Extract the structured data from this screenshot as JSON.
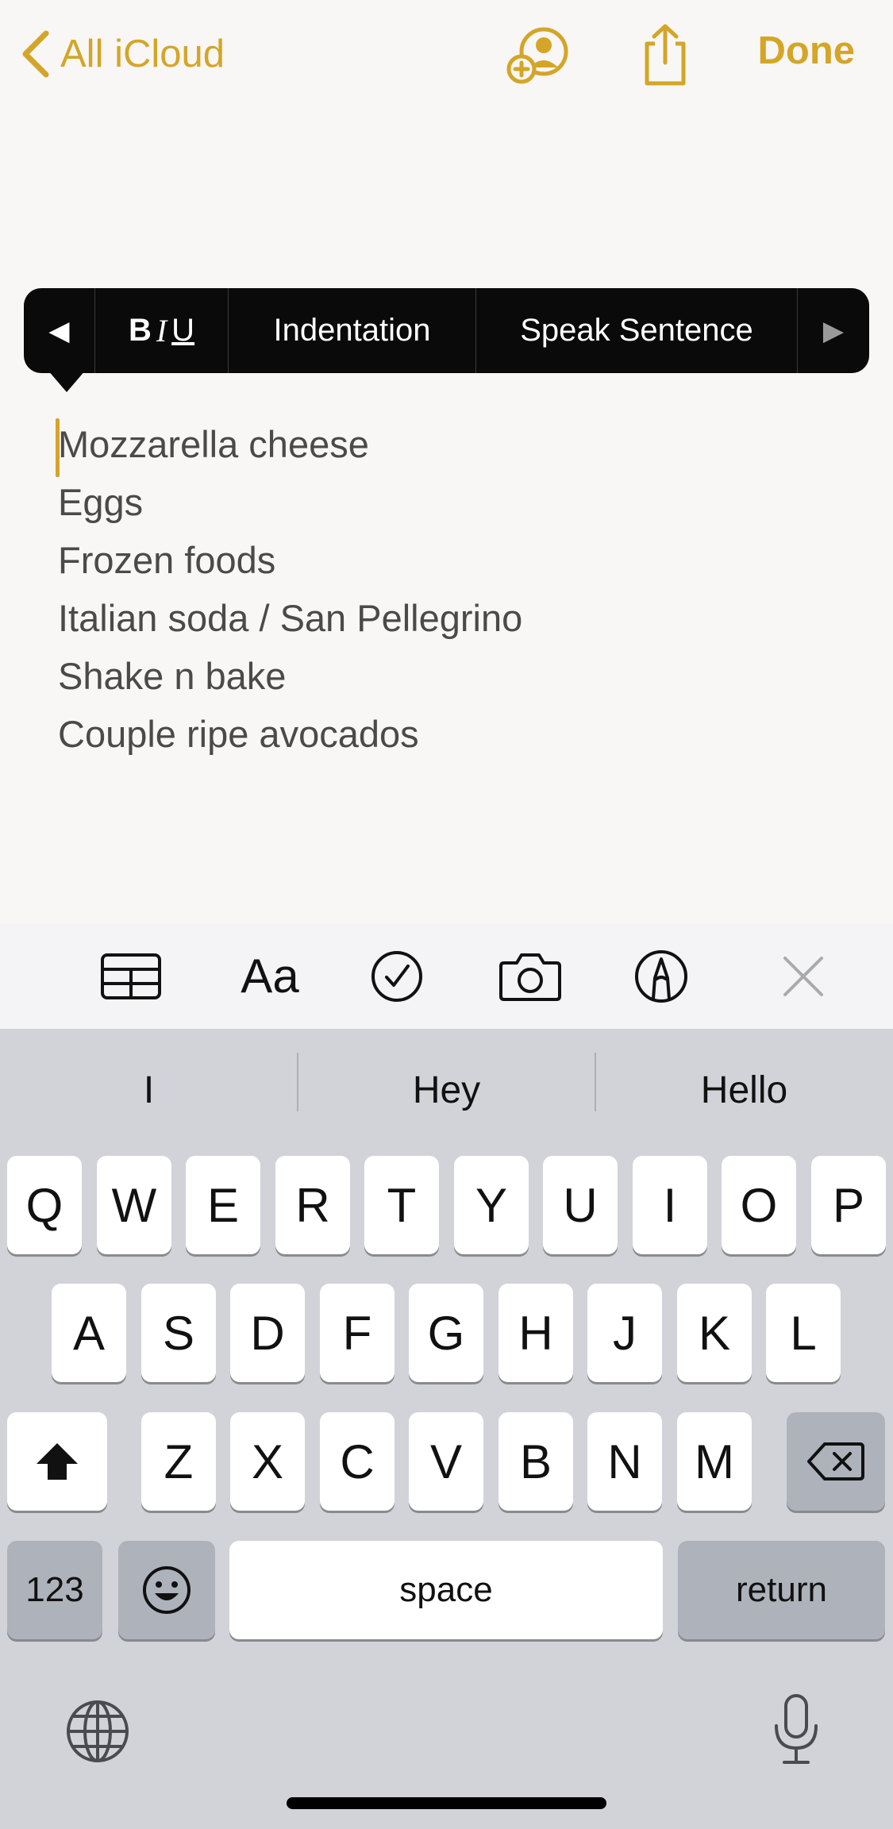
{
  "nav": {
    "back_label": "All iCloud",
    "done_label": "Done",
    "icons": [
      "chevron-left-icon",
      "add-person-icon",
      "share-icon"
    ],
    "accent_color": "#d4a528"
  },
  "edit_menu": {
    "prev_symbol": "◀",
    "bold": "B",
    "italic": "I",
    "underline": "U",
    "indentation": "Indentation",
    "speak_sentence": "Speak Sentence",
    "next_symbol": "▶"
  },
  "note": {
    "lines": [
      "Mozzarella cheese",
      "Eggs",
      "Frozen foods",
      "Italian soda / San Pellegrino",
      "Shake n bake",
      "Couple ripe avocados"
    ]
  },
  "format_toolbar": {
    "aa_label": "Aa",
    "icons": [
      "table-icon",
      "text-format-icon",
      "checklist-icon",
      "camera-icon",
      "markup-pen-icon",
      "close-icon"
    ]
  },
  "keyboard": {
    "suggestions": [
      "I",
      "Hey",
      "Hello"
    ],
    "row1": [
      "Q",
      "W",
      "E",
      "R",
      "T",
      "Y",
      "U",
      "I",
      "O",
      "P"
    ],
    "row2": [
      "A",
      "S",
      "D",
      "F",
      "G",
      "H",
      "J",
      "K",
      "L"
    ],
    "row3": [
      "Z",
      "X",
      "C",
      "V",
      "B",
      "N",
      "M"
    ],
    "numbers_label": "123",
    "space_label": "space",
    "return_label": "return",
    "icons": [
      "shift-icon",
      "backspace-icon",
      "emoji-icon",
      "globe-icon",
      "microphone-icon"
    ]
  }
}
